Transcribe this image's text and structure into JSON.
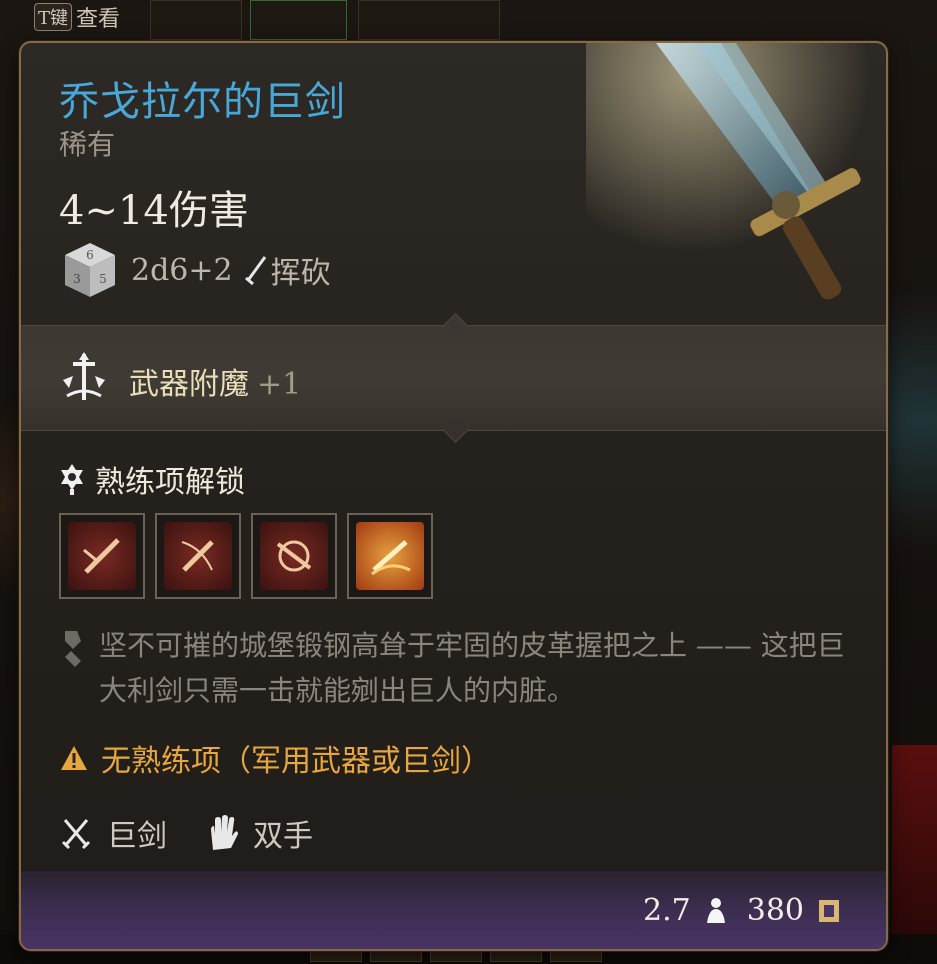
{
  "hud": {
    "key_hint_key": "T键",
    "key_hint_label": "查看"
  },
  "item": {
    "name": "乔戈拉尔的巨剑",
    "rarity": "稀有",
    "damage_range": "4~14伤害",
    "damage_dice": "2d6+2",
    "damage_type": "挥砍",
    "enchant_label": "武器附魔",
    "enchant_bonus": "+1",
    "proficiency_unlock_label": "熟练项解锁",
    "actions": [
      {
        "icon": "cleave-action-icon"
      },
      {
        "icon": "lacerate-action-icon"
      },
      {
        "icon": "pommel-strike-icon"
      },
      {
        "icon": "flaming-slash-icon"
      }
    ],
    "flavor_text": "坚不可摧的城堡锻钢高耸于牢固的皮革握把之上 —— 这把巨大利剑只需一击就能剜出巨人的内脏。",
    "warning": "无熟练项（军用武器或巨剑）",
    "weapon_type": "巨剑",
    "handedness": "双手",
    "weight": "2.7",
    "value": "380"
  },
  "colors": {
    "title": "#48a8d8",
    "warning": "#e7a73e",
    "footer_purple": "#4a3366",
    "border_gold": "#8a6a44"
  }
}
